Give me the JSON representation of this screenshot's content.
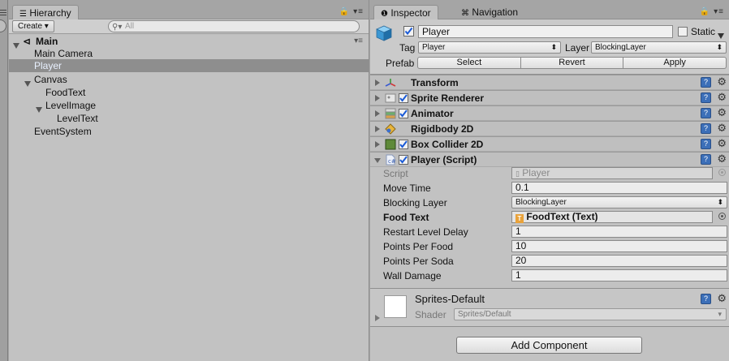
{
  "hierarchy": {
    "tab_label": "Hierarchy",
    "create_label": "Create",
    "search_placeholder": "All",
    "scene_name": "Main",
    "items": [
      {
        "label": "Main Camera"
      },
      {
        "label": "Player"
      },
      {
        "label": "Canvas"
      },
      {
        "label": "FoodText"
      },
      {
        "label": "LevelImage"
      },
      {
        "label": "LevelText"
      },
      {
        "label": "EventSystem"
      }
    ]
  },
  "inspector": {
    "tab_label": "Inspector",
    "nav_tab_label": "Navigation",
    "object_name": "Player",
    "static_label": "Static",
    "tag_label": "Tag",
    "tag_value": "Player",
    "layer_label": "Layer",
    "layer_value": "BlockingLayer",
    "prefab_label": "Prefab",
    "prefab_buttons": [
      "Select",
      "Revert",
      "Apply"
    ],
    "components": [
      {
        "name": "Transform"
      },
      {
        "name": "Sprite Renderer"
      },
      {
        "name": "Animator"
      },
      {
        "name": "Rigidbody 2D"
      },
      {
        "name": "Box Collider 2D"
      },
      {
        "name": "Player (Script)"
      }
    ],
    "script_props": [
      {
        "label": "Script",
        "value": "Player"
      },
      {
        "label": "Move Time",
        "value": "0.1"
      },
      {
        "label": "Blocking Layer",
        "value": "BlockingLayer"
      },
      {
        "label": "Food Text",
        "value": "FoodText (Text)"
      },
      {
        "label": "Restart Level Delay",
        "value": "1"
      },
      {
        "label": "Points Per Food",
        "value": "10"
      },
      {
        "label": "Points Per Soda",
        "value": "20"
      },
      {
        "label": "Wall Damage",
        "value": "1"
      }
    ],
    "material": {
      "name": "Sprites-Default",
      "shader_label": "Shader",
      "shader_value": "Sprites/Default"
    },
    "add_component_label": "Add Component"
  }
}
